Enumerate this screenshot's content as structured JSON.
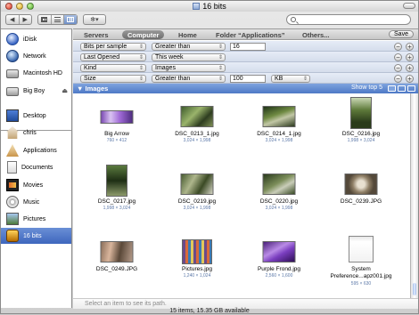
{
  "window": {
    "title": "16 bits"
  },
  "toolbar": {
    "back_icon": "◀",
    "forward_icon": "▶",
    "view_icons": [
      "grid-view-icon",
      "list-view-icon",
      "column-view-icon"
    ],
    "action_icon": "gear-icon",
    "action_label": "✻▾",
    "search_value": ""
  },
  "sidebar": {
    "items": [
      {
        "label": "iDisk",
        "icon": "idisk-icon"
      },
      {
        "label": "Network",
        "icon": "network-icon"
      },
      {
        "label": "Macintosh HD",
        "icon": "hard-disk-icon"
      },
      {
        "label": "Big Boy",
        "icon": "external-disk-icon",
        "eject": "⏏"
      },
      {
        "label": "Desktop",
        "icon": "desktop-icon"
      },
      {
        "label": "chris",
        "icon": "home-icon"
      },
      {
        "label": "Applications",
        "icon": "applications-icon"
      },
      {
        "label": "Documents",
        "icon": "documents-icon"
      },
      {
        "label": "Movies",
        "icon": "movies-icon"
      },
      {
        "label": "Music",
        "icon": "music-icon"
      },
      {
        "label": "Pictures",
        "icon": "pictures-icon"
      },
      {
        "label": "16 bits",
        "icon": "smart-folder-icon",
        "selected": true
      }
    ]
  },
  "scopes": {
    "servers": "Servers",
    "computer": "Computer",
    "home": "Home",
    "folder": "Folder “Applications”",
    "others": "Others...",
    "save": "Save"
  },
  "criteria": [
    {
      "attr": "Bits per sample",
      "op": "Greater than",
      "value": "16"
    },
    {
      "attr": "Last Opened",
      "op": "This week"
    },
    {
      "attr": "Kind",
      "op": "Images"
    },
    {
      "attr": "Size",
      "op": "Greater than",
      "value": "100",
      "unit": "KB"
    }
  ],
  "criteria_buttons": {
    "remove": "−",
    "add": "+"
  },
  "group": {
    "title": "▼ Images",
    "show": "Show top 5"
  },
  "items": [
    {
      "name": "Big Arrow",
      "dims": "760 × 412"
    },
    {
      "name": "DSC_0213_1.jpg",
      "dims": "3,024 × 1,998"
    },
    {
      "name": "DSC_0214_1.jpg",
      "dims": "3,024 × 1,998"
    },
    {
      "name": "DSC_0216.jpg",
      "dims": "1,998 × 3,024"
    },
    {
      "name": "DSC_0217.jpg",
      "dims": "1,998 × 3,024"
    },
    {
      "name": "DSC_0219.jpg",
      "dims": "3,024 × 1,998"
    },
    {
      "name": "DSC_0220.jpg",
      "dims": "3,024 × 1,998"
    },
    {
      "name": "DSC_0239.JPG",
      "dims": ""
    },
    {
      "name": "DSC_0249.JPG",
      "dims": ""
    },
    {
      "name": "Pictures.jpg",
      "dims": "1,240 × 1,024"
    },
    {
      "name": "Purple Frond.jpg",
      "dims": "2,560 × 1,600"
    },
    {
      "name": "System Preference...apz001.jpg",
      "dims": "595 × 630"
    }
  ],
  "pathbar": "Select an item to see its path.",
  "status": "15 items, 15.35 GB available"
}
